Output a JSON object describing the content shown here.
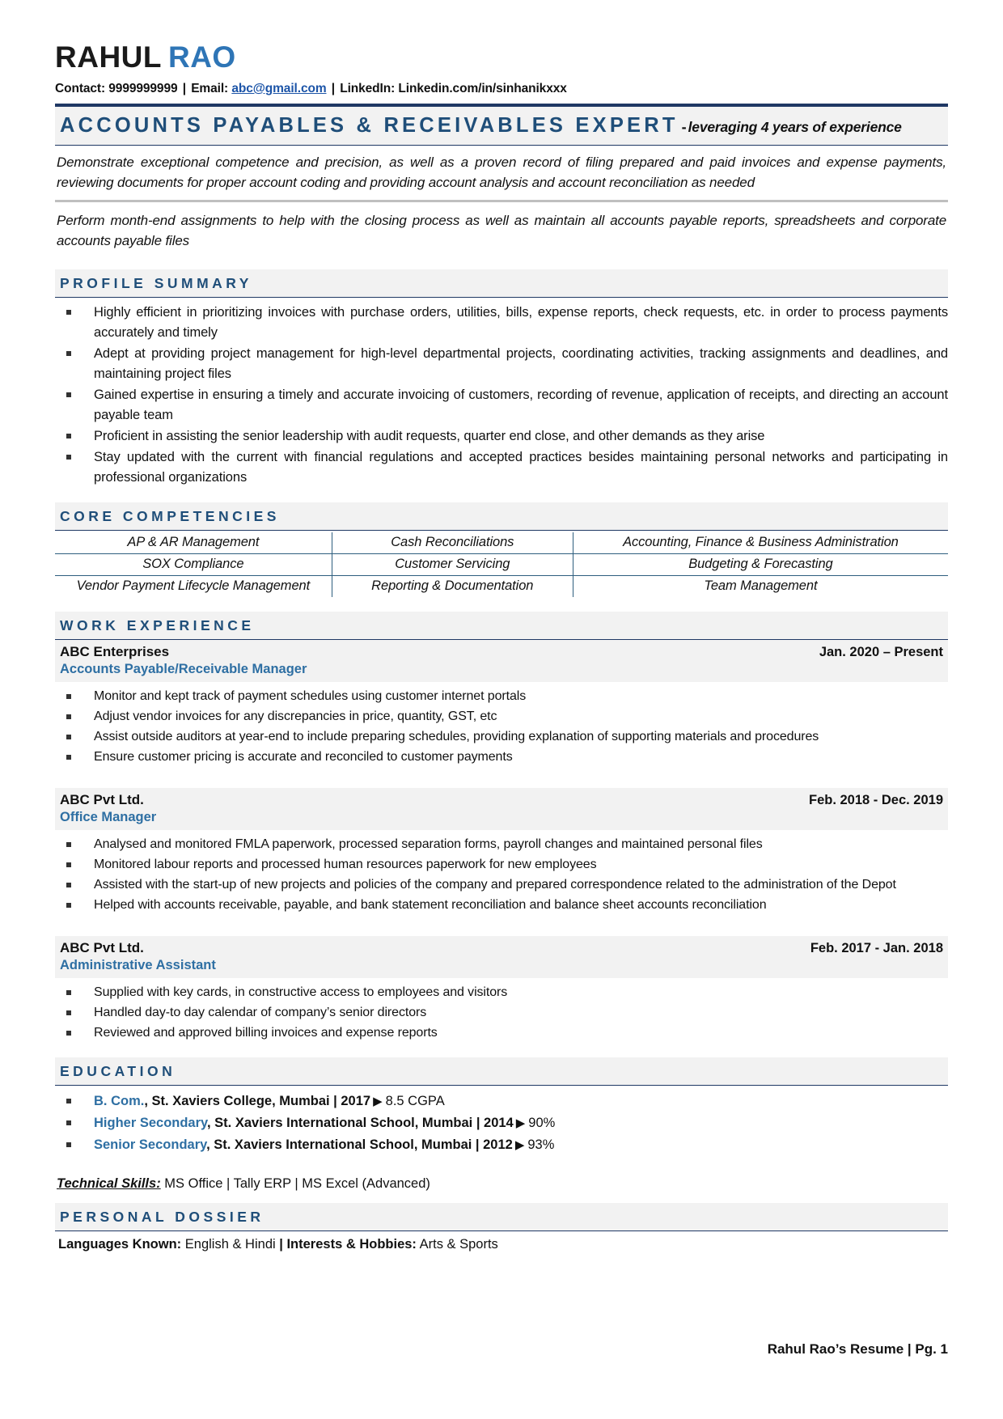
{
  "header": {
    "first_name": "RAHUL",
    "last_name": "RAO",
    "contact_label": "Contact:",
    "phone": "9999999999",
    "email_label": "Email:",
    "email": "abc@gmail.com",
    "linkedin_label": "LinkedIn:",
    "linkedin": "Linkedin.com/in/sinhanikxxx",
    "separator": "|"
  },
  "headline": {
    "title": "ACCOUNTS PAYABLES & RECEIVABLES EXPERT",
    "dash": "-",
    "subtitle": "leveraging 4 years of experience"
  },
  "intro": {
    "paragraph_1": "Demonstrate exceptional competence and precision, as well as a proven record of filing prepared and paid invoices and expense payments, reviewing documents for proper account coding and providing account analysis and account reconciliation as needed",
    "paragraph_2": "Perform month-end assignments to help with the closing process as well as maintain all accounts payable reports, spreadsheets and corporate accounts payable files"
  },
  "profile_summary": {
    "heading": "PROFILE SUMMARY",
    "bullets": [
      "Highly efficient in prioritizing invoices with purchase orders, utilities, bills, expense reports, check requests, etc. in order to process payments accurately and timely",
      "Adept at providing project management for high-level departmental projects, coordinating activities, tracking assignments and deadlines, and maintaining project files",
      "Gained expertise in ensuring a timely and accurate invoicing of customers, recording of revenue, application of receipts, and directing an account payable team",
      "Proficient in assisting the senior leadership with audit requests, quarter end close, and other demands as they arise",
      "Stay updated with the current with financial regulations and accepted practices besides maintaining personal networks and participating in professional organizations"
    ]
  },
  "core_competencies": {
    "heading": "CORE COMPETENCIES",
    "rows": [
      [
        "AP & AR Management",
        "Cash Reconciliations",
        "Accounting, Finance & Business Administration"
      ],
      [
        "SOX Compliance",
        "Customer Servicing",
        "Budgeting & Forecasting"
      ],
      [
        "Vendor Payment Lifecycle Management",
        "Reporting & Documentation",
        "Team Management"
      ]
    ]
  },
  "work_experience": {
    "heading": "WORK EXPERIENCE",
    "jobs": [
      {
        "company": "ABC Enterprises",
        "dates": "Jan. 2020 – Present",
        "title": "Accounts Payable/Receivable Manager",
        "bullets": [
          "Monitor and kept track of payment schedules using customer internet portals",
          "Adjust vendor invoices for any discrepancies in price, quantity, GST, etc",
          "Assist outside auditors at year-end to include preparing schedules, providing explanation of supporting materials and procedures",
          "Ensure customer pricing is accurate and reconciled to customer payments"
        ]
      },
      {
        "company": "ABC Pvt Ltd.",
        "dates": "Feb. 2018 - Dec. 2019",
        "title": "Office Manager",
        "bullets": [
          "Analysed and monitored FMLA paperwork, processed separation forms, payroll changes and maintained personal files",
          "Monitored labour reports and processed human resources paperwork for new employees",
          "Assisted with the start-up of new projects and policies of the company and prepared correspondence related to the administration of the Depot",
          "Helped with accounts receivable, payable, and bank statement reconciliation and balance sheet accounts reconciliation"
        ]
      },
      {
        "company": "ABC Pvt Ltd.",
        "dates": "Feb. 2017 - Jan. 2018",
        "title": "Administrative Assistant",
        "bullets": [
          "Supplied with key cards, in constructive access to employees and visitors",
          "Handled day-to day calendar of company’s senior directors",
          "Reviewed and approved billing invoices and expense reports"
        ]
      }
    ]
  },
  "education": {
    "heading": "EDUCATION",
    "items": [
      {
        "degree": "B. Com.",
        "comma": ",",
        "institution": "St. Xaviers College, Mumbai | 2017",
        "arrow": "▶",
        "score": "8.5 CGPA"
      },
      {
        "degree": "Higher Secondary",
        "comma": ",",
        "institution": "St. Xaviers International School, Mumbai | 2014",
        "arrow": "▶",
        "score": "90%"
      },
      {
        "degree": "Senior Secondary",
        "comma": ",",
        "institution": "St. Xaviers International School, Mumbai | 2012",
        "arrow": "▶",
        "score": "93%"
      }
    ]
  },
  "technical_skills": {
    "label": "Technical Skills:",
    "value": "MS Office | Tally ERP | MS Excel (Advanced)"
  },
  "personal_dossier": {
    "heading": "PERSONAL DOSSIER",
    "languages_label": "Languages Known:",
    "languages_value": "English & Hindi",
    "divider": "|",
    "interests_label": "Interests & Hobbies:",
    "interests_value": "Arts & Sports"
  },
  "footer": {
    "text": "Rahul Rao’s Resume | Pg. 1"
  },
  "colors": {
    "accent_blue": "#2E75B6",
    "heading_blue": "#1F4E79",
    "rule_navy": "#1F3864",
    "band_grey": "#F2F2F2",
    "table_border": "#2E5E7E"
  }
}
